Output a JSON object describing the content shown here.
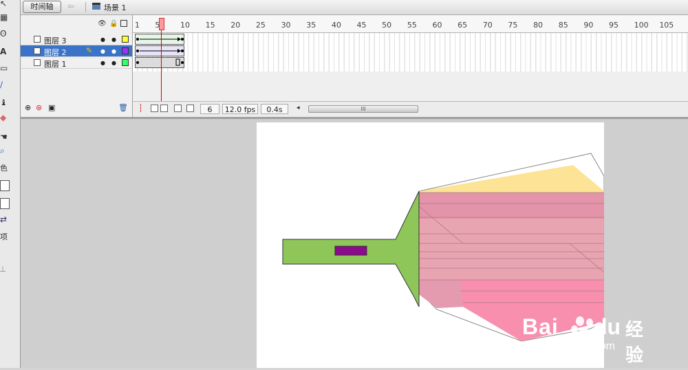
{
  "toolbar": {
    "timeline_button": "时间轴",
    "back_icon": "left-arrow-icon",
    "scene_label": "场景 1"
  },
  "tools_panel": {
    "items": [
      {
        "name": "arrow-tool-icon",
        "glyph": "↖"
      },
      {
        "name": "subselect-tool-icon",
        "glyph": "▦"
      },
      {
        "name": "lasso-tool-icon",
        "glyph": "ʘ"
      },
      {
        "name": "text-tool-icon",
        "glyph": "A"
      },
      {
        "name": "rectangle-tool-icon",
        "glyph": "▭"
      },
      {
        "name": "brush-tool-icon",
        "glyph": "/"
      },
      {
        "name": "paint-bucket-icon",
        "glyph": "♝"
      },
      {
        "name": "eraser-tool-icon",
        "glyph": "◇"
      },
      {
        "name": "hand-tool-icon",
        "glyph": "✋"
      },
      {
        "name": "zoom-tool-icon",
        "glyph": "🔍"
      }
    ],
    "label_color": "色",
    "label_options": "项"
  },
  "timeline": {
    "header_icons": [
      "eye-icon",
      "lock-icon",
      "outline-icon"
    ],
    "ruler_labels": [
      "1",
      "5",
      "10",
      "15",
      "20",
      "25",
      "30",
      "35",
      "40",
      "45",
      "50",
      "55",
      "60",
      "65",
      "70",
      "75",
      "80",
      "85",
      "90",
      "95",
      "100",
      "105"
    ],
    "layers": [
      {
        "name": "图层 3",
        "color": "#ffff33",
        "selected": false
      },
      {
        "name": "图层 2",
        "color": "#9933ff",
        "selected": true
      },
      {
        "name": "图层 1",
        "color": "#33ff66",
        "selected": false
      }
    ],
    "current_frame": "6",
    "fps": "12.0 fps",
    "elapsed": "0.4s",
    "scroll_grip": "III"
  },
  "watermark": {
    "logo_text": "Bai",
    "logo_text2": "du",
    "logo_cn": "经验",
    "url": "jingyan.baidu.com"
  }
}
